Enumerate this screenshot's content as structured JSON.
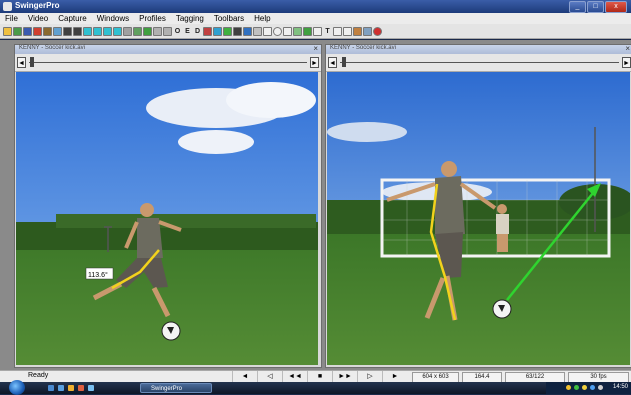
{
  "app": {
    "title": "SwingerPro"
  },
  "menu": [
    "File",
    "Video",
    "Capture",
    "Windows",
    "Profiles",
    "Tagging",
    "Toolbars",
    "Help"
  ],
  "toolbar": {
    "text_buttons": [
      "O",
      "E",
      "D",
      "T"
    ]
  },
  "panels": {
    "left": {
      "title": "KENNY - Soccer kick.avi",
      "angle_label": "113.6°"
    },
    "right": {
      "title": "KENNY - Soccer kick.avi"
    }
  },
  "status": {
    "ready": "Ready",
    "resolution": "604 x 603",
    "value": "164.4",
    "frame": "63/122",
    "fps": "30 fps"
  },
  "transport": [
    "◄",
    "◁",
    "◄◄",
    "■",
    "►►",
    "▷",
    "►"
  ],
  "taskbar": {
    "item": "SwingerPro",
    "clock": "14:50"
  },
  "colors": {
    "overlay_yellow": "#f2d21c",
    "arrow_green": "#2fd42f"
  }
}
